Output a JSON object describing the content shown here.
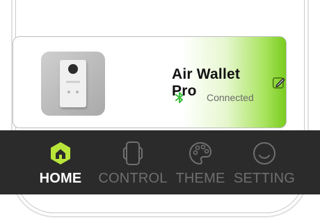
{
  "device_card": {
    "name": "Air Wallet Pro",
    "status": "Connected",
    "thumbnail_alt": "device thumbnail",
    "accent_color": "#79cc1f"
  },
  "bottom_nav": {
    "items": [
      {
        "label": "HOME",
        "icon": "home-hexagon-icon",
        "active": true
      },
      {
        "label": "CONTROL",
        "icon": "device-control-icon",
        "active": false
      },
      {
        "label": "THEME",
        "icon": "palette-icon",
        "active": false
      },
      {
        "label": "SETTING",
        "icon": "smile-settings-icon",
        "active": false
      }
    ],
    "active_color": "#b9e53a",
    "inactive_color": "#6f6f6f",
    "background": "#2b2b2b"
  }
}
